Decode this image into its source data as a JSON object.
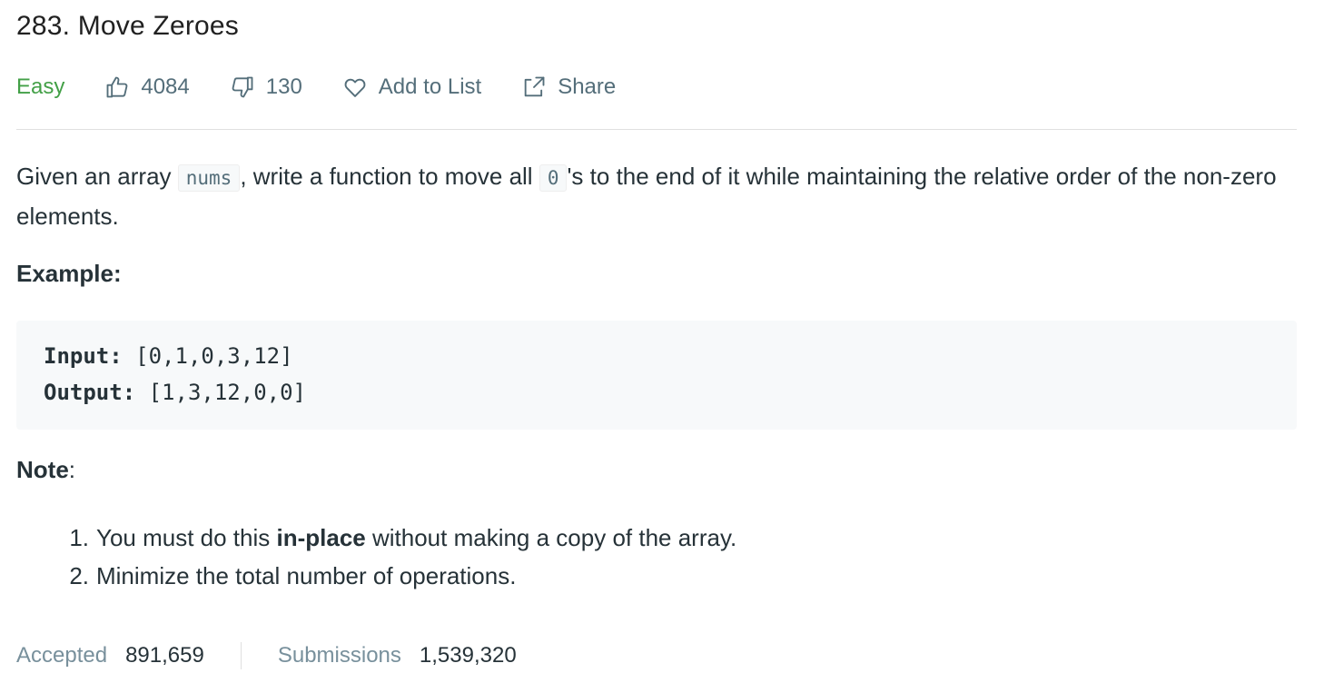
{
  "problem": {
    "title": "283. Move Zeroes",
    "difficulty": "Easy",
    "likes": "4084",
    "dislikes": "130",
    "add_to_list": "Add to List",
    "share": "Share"
  },
  "description": {
    "part1": "Given an array ",
    "code1": "nums",
    "part2": ", write a function to move all ",
    "code2": "0",
    "part3": "'s to the end of it while maintaining the relative order of the non-zero elements."
  },
  "example": {
    "label": "Example:",
    "input_label": "Input:",
    "input_value": "[0,1,0,3,12]",
    "output_label": "Output:",
    "output_value": "[1,3,12,0,0]"
  },
  "note": {
    "label": "Note",
    "colon": ":",
    "items": [
      {
        "num": "1.",
        "before": "You must do this ",
        "bold": "in-place",
        "after": " without making a copy of the array."
      },
      {
        "num": "2.",
        "before": "Minimize the total number of operations.",
        "bold": "",
        "after": ""
      }
    ]
  },
  "stats": {
    "accepted_label": "Accepted",
    "accepted_value": "891,659",
    "submissions_label": "Submissions",
    "submissions_value": "1,539,320"
  },
  "colors": {
    "easy": "#43a047",
    "muted": "#546e7a",
    "text": "#263238"
  },
  "icons": [
    "thumbs-up-icon",
    "thumbs-down-icon",
    "heart-icon",
    "share-icon"
  ]
}
